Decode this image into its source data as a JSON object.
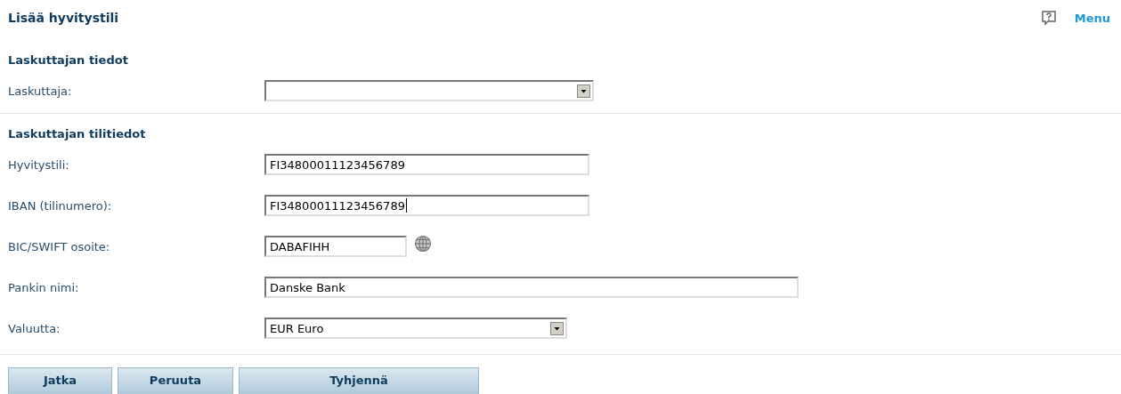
{
  "title": "Lisää hyvitystili",
  "menu_link": "Menu",
  "sections": [
    {
      "heading": "Laskuttajan tiedot",
      "fields": [
        {
          "kind": "select",
          "label": "Laskuttaja:"
        }
      ]
    },
    {
      "heading": "Laskuttajan tilitiedot",
      "fields": [
        {
          "kind": "text",
          "label": "Hyvitystili:",
          "value": "FI34800011123456789",
          "focused": false
        },
        {
          "kind": "text",
          "label": "IBAN (tilinumero):",
          "value": "FI34800011123456789",
          "focused": true
        },
        {
          "kind": "lookup",
          "label": "BIC/SWIFT osoite:",
          "value": "DABAFIHH",
          "focused": false
        },
        {
          "kind": "text",
          "label": "Pankin nimi:",
          "value": "Danske Bank",
          "focused": false
        },
        {
          "kind": "select",
          "label": "Valuutta:",
          "value": "EUR Euro"
        }
      ]
    }
  ],
  "buttons": [
    "Jatka",
    "Peruuta",
    "Tyhjennä"
  ]
}
